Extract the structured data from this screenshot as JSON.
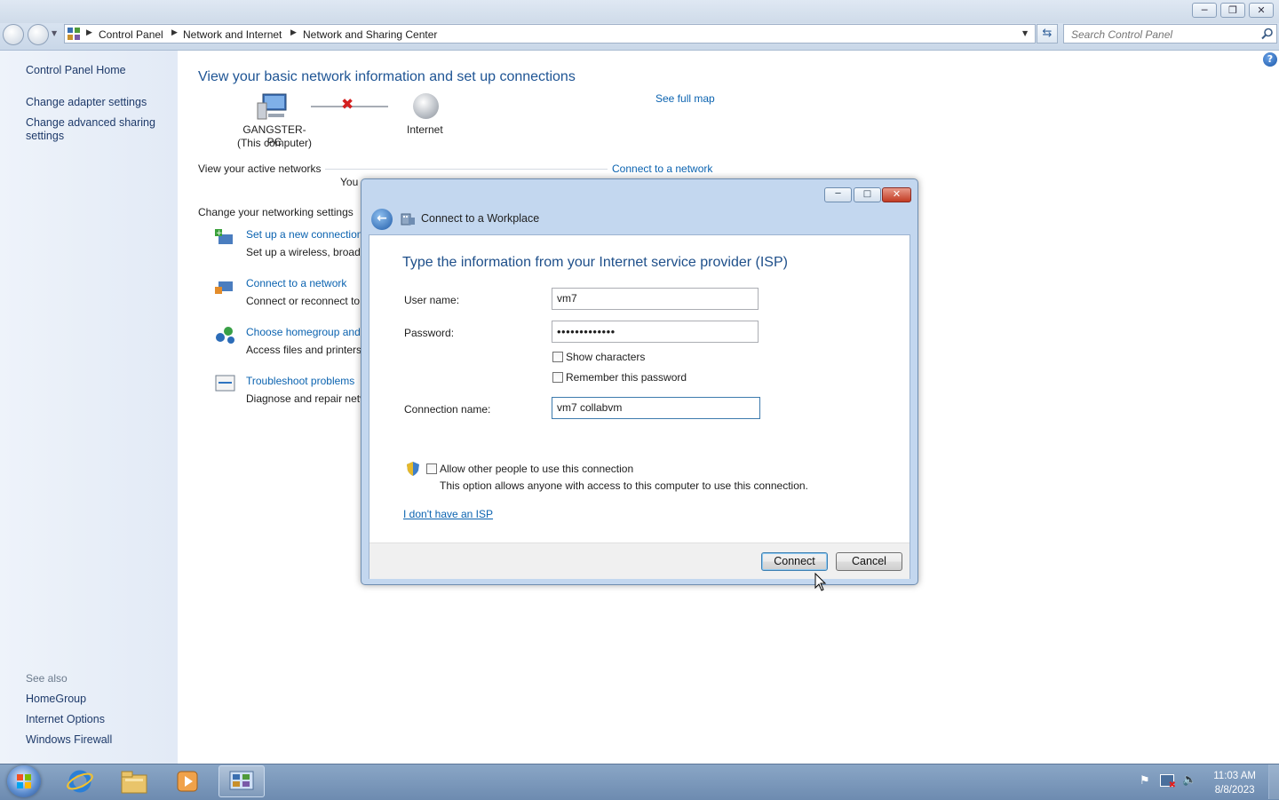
{
  "window": {
    "minimize_icon": "minimize-icon",
    "restore_icon": "restore-icon",
    "close_icon": "close-icon"
  },
  "address": {
    "breadcrumbs": [
      "Control Panel",
      "Network and Internet",
      "Network and Sharing Center"
    ],
    "search_placeholder": "Search Control Panel"
  },
  "sidebar": {
    "home": "Control Panel Home",
    "links": [
      "Change adapter settings",
      "Change advanced sharing settings"
    ],
    "see_also_title": "See also",
    "see_also": [
      "HomeGroup",
      "Internet Options",
      "Windows Firewall"
    ]
  },
  "main": {
    "heading": "View your basic network information and set up connections",
    "see_full_map": "See full map",
    "computer_name": "GANGSTER-PC",
    "computer_sub": "(This computer)",
    "internet_label": "Internet",
    "active_networks": "View your active networks",
    "connect_to_network": "Connect to a network",
    "active_partial": "You",
    "change_settings": "Change your networking settings",
    "tasks": [
      {
        "title": "Set up a new connection",
        "desc": "Set up a wireless, broadb"
      },
      {
        "title": "Connect to a network",
        "desc": "Connect or reconnect to"
      },
      {
        "title": "Choose homegroup and",
        "desc": "Access files and printers"
      },
      {
        "title": "Troubleshoot problems",
        "desc": "Diagnose and repair netv"
      }
    ]
  },
  "dialog": {
    "title": "Connect to a Workplace",
    "heading": "Type the information from your Internet service provider (ISP)",
    "username_label": "User name:",
    "username_value": "vm7",
    "password_label": "Password:",
    "password_value": "•••••••••••••",
    "show_characters": "Show characters",
    "remember_password": "Remember this password",
    "connection_name_label": "Connection name:",
    "connection_name_value": "vm7 collabvm",
    "allow_others": "Allow other people to use this connection",
    "allow_others_desc": "This option allows anyone with access to this computer to use this connection.",
    "no_isp_link": "I don't have an ISP",
    "connect_button": "Connect",
    "cancel_button": "Cancel"
  },
  "taskbar": {
    "time": "11:03 AM",
    "date": "8/8/2023"
  }
}
